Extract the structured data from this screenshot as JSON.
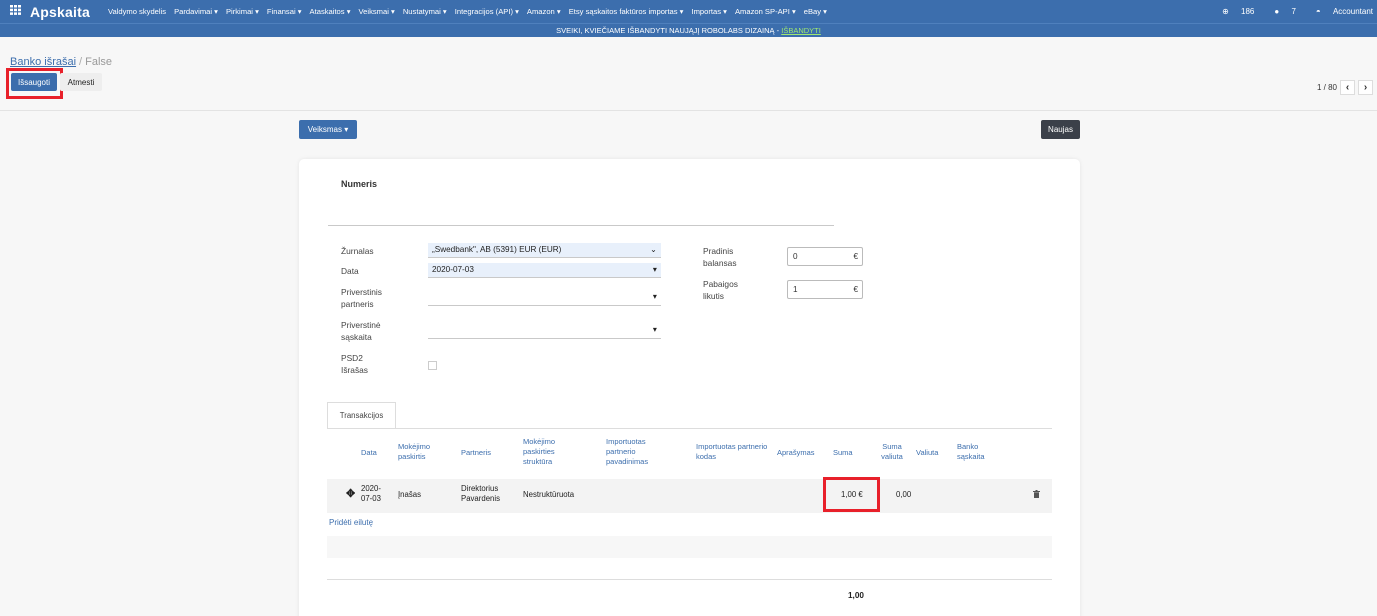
{
  "topbar": {
    "apps_icon": "grid-icon",
    "brand": "Apskaita",
    "menu": [
      "Valdymo skydelis",
      "Pardavimai ▾",
      "Pirkimai ▾",
      "Finansai ▾",
      "Ataskaitos ▾",
      "Veiksmai ▾",
      "Nustatymai ▾",
      "Integracijos (API) ▾",
      "Amazon ▾",
      "Etsy sąskaitos faktūros importas ▾",
      "Importas ▾",
      "Amazon SP-API ▾",
      "eBay ▾"
    ],
    "activity_count": "186",
    "messages_count": "7",
    "user": "Accountant"
  },
  "banner": {
    "text": "SVEIKI, KVIEČIAME IŠBANDYTI NAUJĄJĮ ROBOLABS DIZAINĄ - ",
    "link": "IŠBANDYTI"
  },
  "breadcrumb": {
    "parent": "Banko išrašai",
    "sep": "/",
    "current": "False"
  },
  "buttons": {
    "save": "Išsaugoti",
    "discard": "Atmesti",
    "action": "Veiksmas ▾",
    "new": "Naujas"
  },
  "pager": {
    "text": "1 / 80",
    "prev": "‹",
    "next": "›"
  },
  "form": {
    "number_label": "Numeris",
    "journal_label": "Žurnalas",
    "journal_value": "„Swedbank\", AB (5391) EUR (EUR)",
    "date_label": "Data",
    "date_value": "2020-07-03",
    "partner_label_1": "Priverstinis",
    "partner_label_2": "partneris",
    "account_label_1": "Priverstinė",
    "account_label_2": "sąskaita",
    "psd2_label_1": "PSD2",
    "psd2_label_2": "Išrašas",
    "start_label_1": "Pradinis",
    "start_label_2": "balansas",
    "start_value": "0",
    "end_label_1": "Pabaigos",
    "end_label_2": "likutis",
    "end_value": "1",
    "currency_symbol": "€"
  },
  "tab": "Transakcijos",
  "columns": [
    "Data",
    "Mokėjimo paskirtis",
    "Partneris",
    "Mokėjimo paskirties struktūra",
    "Importuotas partnerio pavadinimas",
    "Importuotas partnerio kodas",
    "Aprašymas",
    "Suma",
    "Suma valiuta",
    "Valiuta",
    "Banko sąskaita"
  ],
  "rows": [
    {
      "date_1": "2020-",
      "date_2": "07-03",
      "purpose": "Įnašas",
      "partner_1": "Direktorius",
      "partner_2": "Pavardenis",
      "structure": "Nestruktūruota",
      "amount": "1,00 €",
      "amount_currency": "0,00"
    }
  ],
  "add_line": "Pridėti eilutę",
  "total": "1,00"
}
